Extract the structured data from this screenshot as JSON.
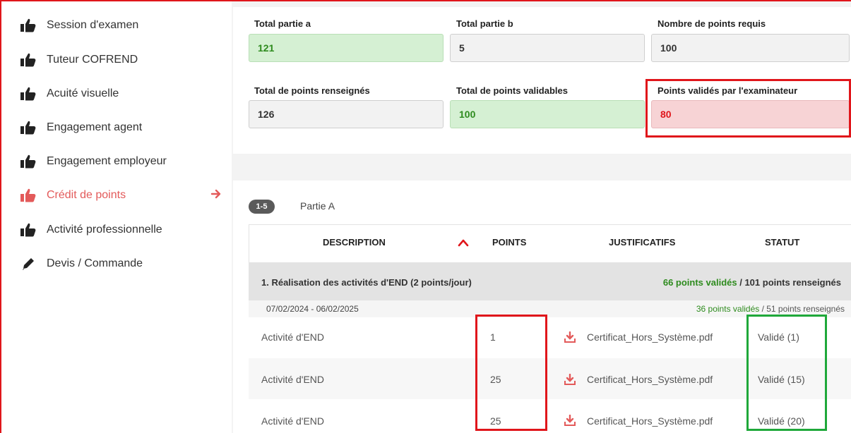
{
  "sidebar": {
    "items": [
      {
        "label": "Session d'examen",
        "icon": "thumbs-up-icon"
      },
      {
        "label": "Tuteur COFREND",
        "icon": "thumbs-up-icon"
      },
      {
        "label": "Acuité visuelle",
        "icon": "thumbs-up-icon"
      },
      {
        "label": "Engagement agent",
        "icon": "thumbs-up-icon"
      },
      {
        "label": "Engagement employeur",
        "icon": "thumbs-up-icon"
      },
      {
        "label": "Crédit de points",
        "icon": "thumbs-up-icon",
        "active": true
      },
      {
        "label": "Activité professionnelle",
        "icon": "thumbs-up-icon"
      },
      {
        "label": "Devis / Commande",
        "icon": "pencil-icon"
      }
    ]
  },
  "summary": {
    "total_a": {
      "label": "Total partie a",
      "value": "121"
    },
    "total_b": {
      "label": "Total partie b",
      "value": "5"
    },
    "required": {
      "label": "Nombre de points requis",
      "value": "100"
    },
    "entered": {
      "label": "Total de points renseignés",
      "value": "126"
    },
    "validatable": {
      "label": "Total de points validables",
      "value": "100"
    },
    "examiner": {
      "label": "Points validés par l'examinateur",
      "value": "80"
    }
  },
  "section": {
    "badge": "1-5",
    "title": "Partie A"
  },
  "table": {
    "headers": {
      "description": "DESCRIPTION",
      "points": "POINTS",
      "justificatifs": "JUSTIFICATIFS",
      "statut": "STATUT"
    },
    "group": {
      "title": "1. Réalisation des activités d'END (2 points/jour)",
      "validated": "66 points validés",
      "entered": " / 101 points renseignés"
    },
    "period": {
      "dates": "07/02/2024 - 06/02/2025",
      "validated": "36 points validés",
      "entered": " / 51 points renseignés"
    },
    "rows": [
      {
        "description": "Activité d'END",
        "points": "1",
        "file": "Certificat_Hors_Système.pdf",
        "status": "Validé (1)"
      },
      {
        "description": "Activité d'END",
        "points": "25",
        "file": "Certificat_Hors_Système.pdf",
        "status": "Validé (15)"
      },
      {
        "description": "Activité d'END",
        "points": "25",
        "file": "Certificat_Hors_Système.pdf",
        "status": "Validé (20)"
      }
    ]
  },
  "colors": {
    "accent_red": "#e0161b",
    "active_item": "#e35a5a",
    "valid_green": "#2e8b1e",
    "highlight_green": "#1fa83a"
  }
}
